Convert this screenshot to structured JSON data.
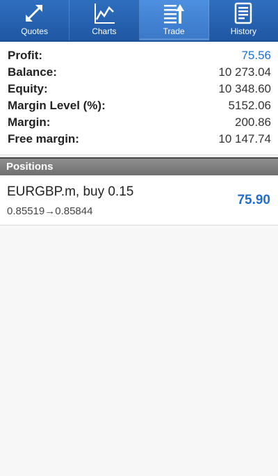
{
  "tabs": [
    {
      "label": "Quotes",
      "icon": "quotes-icon",
      "active": false
    },
    {
      "label": "Charts",
      "icon": "charts-icon",
      "active": false
    },
    {
      "label": "Trade",
      "icon": "trade-icon",
      "active": true
    },
    {
      "label": "History",
      "icon": "history-icon",
      "active": false
    }
  ],
  "account": {
    "profit_label": "Profit:",
    "profit_value": "75.56",
    "balance_label": "Balance:",
    "balance_value": "10 273.04",
    "equity_label": "Equity:",
    "equity_value": "10 348.60",
    "margin_level_label": "Margin Level (%):",
    "margin_level_value": "5152.06",
    "margin_label": "Margin:",
    "margin_value": "200.86",
    "free_margin_label": "Free margin:",
    "free_margin_value": "10 147.74"
  },
  "positions_header": "Positions",
  "positions": [
    {
      "title": "EURGBP.m, buy 0.15",
      "prices": "0.85519→0.85844",
      "profit": "75.90"
    }
  ],
  "colors": {
    "accent": "#2f6fbf",
    "profit_text": "#1e6fd0",
    "section_header": "#7a7a7a"
  }
}
